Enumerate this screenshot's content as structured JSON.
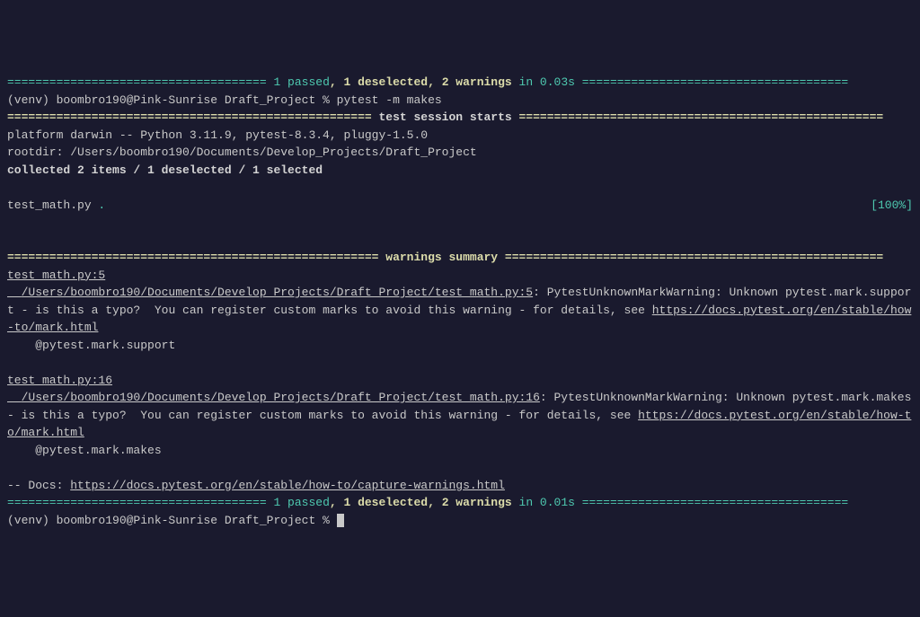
{
  "top_rule_left": "=====================================",
  "top_passed": " 1 passed",
  "top_deselected": ", 1 deselected",
  "top_warnings": ", 2 warnings",
  "top_time": " in 0.03s ",
  "top_rule_right": "======================================",
  "prompt1": "(venv) boombro190@Pink-Sunrise Draft_Project % pytest -m makes",
  "session_rule_left": "==================================================== ",
  "session_label": "test session starts",
  "session_rule_right": " ====================================================",
  "platform": "platform darwin -- Python 3.11.9, pytest-8.3.4, pluggy-1.5.0",
  "rootdir": "rootdir: /Users/boombro190/Documents/Develop_Projects/Draft_Project",
  "collected": "collected 2 items / 1 deselected / 1 selected",
  "testfile": "test_math.py ",
  "dot": ".",
  "percent": "[100%]",
  "warn_rule_left": "===================================================== ",
  "warn_label": "warnings summary",
  "warn_rule_right": " ======================================================",
  "w1_header": "test_math.py:5",
  "w1_path": "  /Users/boombro190/Documents/Develop_Projects/Draft_Project/test_math.py:5",
  "w1_msg1": ": PytestUnknownMarkWarning: Unknown pytest.mark.support",
  "w1_msg2": " - is this a typo?  You can register custom marks to avoid this warning - for details, see ",
  "w1_link": "https://docs.pytest.org/en/stable/how-to/mark.html",
  "w1_decorator": "    @pytest.mark.support",
  "w2_header": "test_math.py:16",
  "w2_path": "  /Users/boombro190/Documents/Develop_Projects/Draft_Project/test_math.py:16",
  "w2_msg1": ": PytestUnknownMarkWarning: Unknown pytest.mark.makes ",
  "w2_msg2": "- is this a typo?  You can register custom marks to avoid this warning - for details, see ",
  "w2_link": "https://docs.pytest.org/en/stable/how-to/mark.html",
  "w2_decorator": "    @pytest.mark.makes",
  "docs_prefix": "-- Docs: ",
  "docs_link": "https://docs.pytest.org/en/stable/how-to/capture-warnings.html",
  "bottom_rule_left": "=====================================",
  "bottom_passed": " 1 passed",
  "bottom_deselected": ", 1 deselected",
  "bottom_warnings": ", 2 warnings",
  "bottom_time": " in 0.01s ",
  "bottom_rule_right": "======================================",
  "prompt2": "(venv) boombro190@Pink-Sunrise Draft_Project % "
}
